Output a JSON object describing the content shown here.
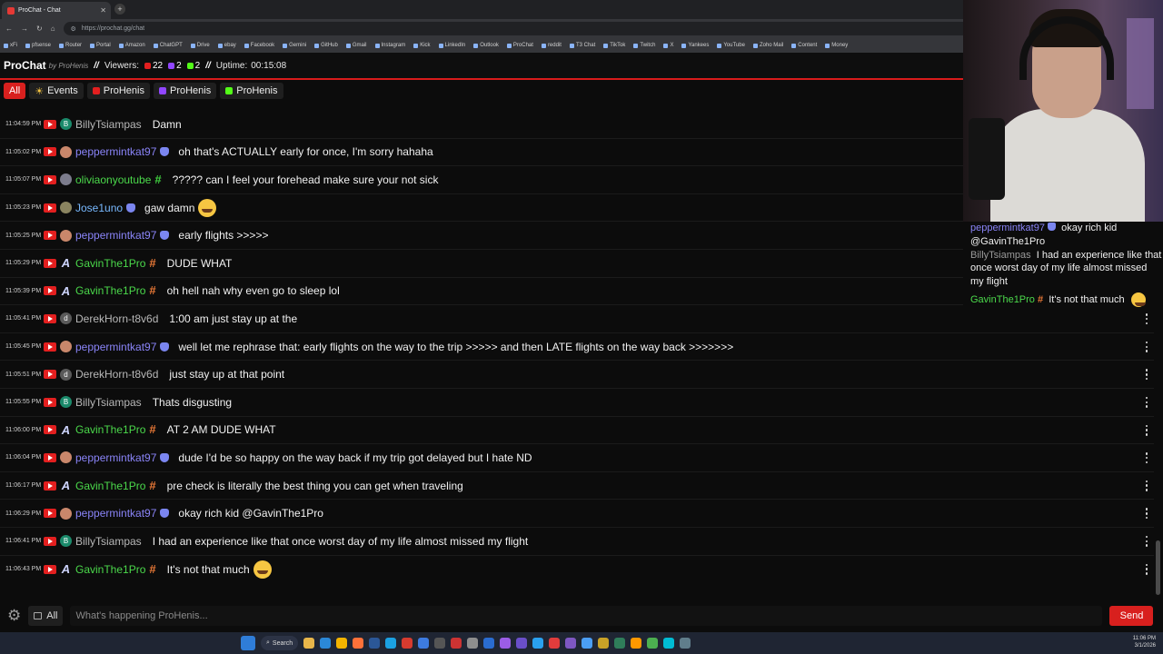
{
  "browser": {
    "tab_title": "ProChat - Chat",
    "url": "https://prochat.gg/chat",
    "bookmarks": [
      "xFi",
      "pfsense",
      "Router",
      "Portal",
      "Amazon",
      "ChatGPT",
      "Drive",
      "ebay",
      "Facebook",
      "Gemini",
      "GitHub",
      "Gmail",
      "Instagram",
      "Kick",
      "LinkedIn",
      "Outlook",
      "ProChat",
      "reddit",
      "T3 Chat",
      "TikTok",
      "Twitch",
      "X",
      "Yankees",
      "YouTube",
      "Zoho Mail",
      "Content",
      "Money"
    ]
  },
  "header": {
    "logo": "ProChat",
    "byline": "by ProHenis",
    "sep1": "//",
    "viewers_label": "Viewers:",
    "youtube_count": "22",
    "twitch_count": "2",
    "kick_count": "2",
    "sep2": "//",
    "uptime_label": "Uptime:",
    "uptime": "00:15:08"
  },
  "filters": {
    "all": "All",
    "events": "Events",
    "youtube": "ProHenis",
    "twitch": "ProHenis",
    "kick": "ProHenis"
  },
  "messages": [
    {
      "time": "11:04:59 PM",
      "user": "BillyTsiampas",
      "text": "Damn"
    },
    {
      "time": "11:05:02 PM",
      "user": "peppermintkat97",
      "text": "oh that's ACTUALLY early for once, I'm sorry hahaha"
    },
    {
      "time": "11:05:07 PM",
      "user": "oliviaonyoutube",
      "text": "????? can I feel your forehead make sure your not sick"
    },
    {
      "time": "11:05:23 PM",
      "user": "Jose1uno",
      "text": "gaw damn"
    },
    {
      "time": "11:05:25 PM",
      "user": "peppermintkat97",
      "text": "early flights >>>>>"
    },
    {
      "time": "11:05:29 PM",
      "user": "GavinThe1Pro",
      "text": "DUDE WHAT"
    },
    {
      "time": "11:05:39 PM",
      "user": "GavinThe1Pro",
      "text": "oh hell nah why even go to sleep lol"
    },
    {
      "time": "11:05:41 PM",
      "user": "DerekHorn-t8v6d",
      "text": "1:00 am just stay up at the"
    },
    {
      "time": "11:05:45 PM",
      "user": "peppermintkat97",
      "text": "well let me rephrase that: early flights on the way to the trip >>>>> and then LATE flights on the way back >>>>>>>"
    },
    {
      "time": "11:05:51 PM",
      "user": "DerekHorn-t8v6d",
      "text": "just stay up at that point"
    },
    {
      "time": "11:05:55 PM",
      "user": "BillyTsiampas",
      "text": "Thats disgusting"
    },
    {
      "time": "11:06:00 PM",
      "user": "GavinThe1Pro",
      "text": "AT 2 AM DUDE WHAT"
    },
    {
      "time": "11:06:04 PM",
      "user": "peppermintkat97",
      "text": "dude I'd be so happy on the way back if my trip got delayed but I hate ND"
    },
    {
      "time": "11:06:17 PM",
      "user": "GavinThe1Pro",
      "text": "pre check is literally the best thing you can get when traveling"
    },
    {
      "time": "11:06:29 PM",
      "user": "peppermintkat97",
      "text": "okay rich kid @GavinThe1Pro"
    },
    {
      "time": "11:06:41 PM",
      "user": "BillyTsiampas",
      "text": "I had an experience like that once worst day of my life almost missed my flight"
    },
    {
      "time": "11:06:43 PM",
      "user": "GavinThe1Pro",
      "text": "It's not that much"
    }
  ],
  "avatar_letters": {
    "b": "B",
    "d": "d",
    "g": "A"
  },
  "input": {
    "filter_label": "All",
    "placeholder": "What's happening ProHenis...",
    "send": "Send"
  },
  "overlay": {
    "l1_user": "peppermintkat97",
    "l1_text": "okay rich kid",
    "l2_text": "@GavinThe1Pro",
    "l3_user": "BillyTsiampas",
    "l3_text": "I had an experience like that once worst day of my life almost missed my flight",
    "l4_user": "GavinThe1Pro",
    "l4_text": "It's not that much"
  },
  "taskbar": {
    "search": "Search",
    "time": "11:06 PM",
    "date": "3/1/2026"
  },
  "colors": {
    "accent": "#d8201e",
    "youtube": "#e31f1f",
    "twitch": "#9146ff",
    "kick": "#53fc18"
  }
}
